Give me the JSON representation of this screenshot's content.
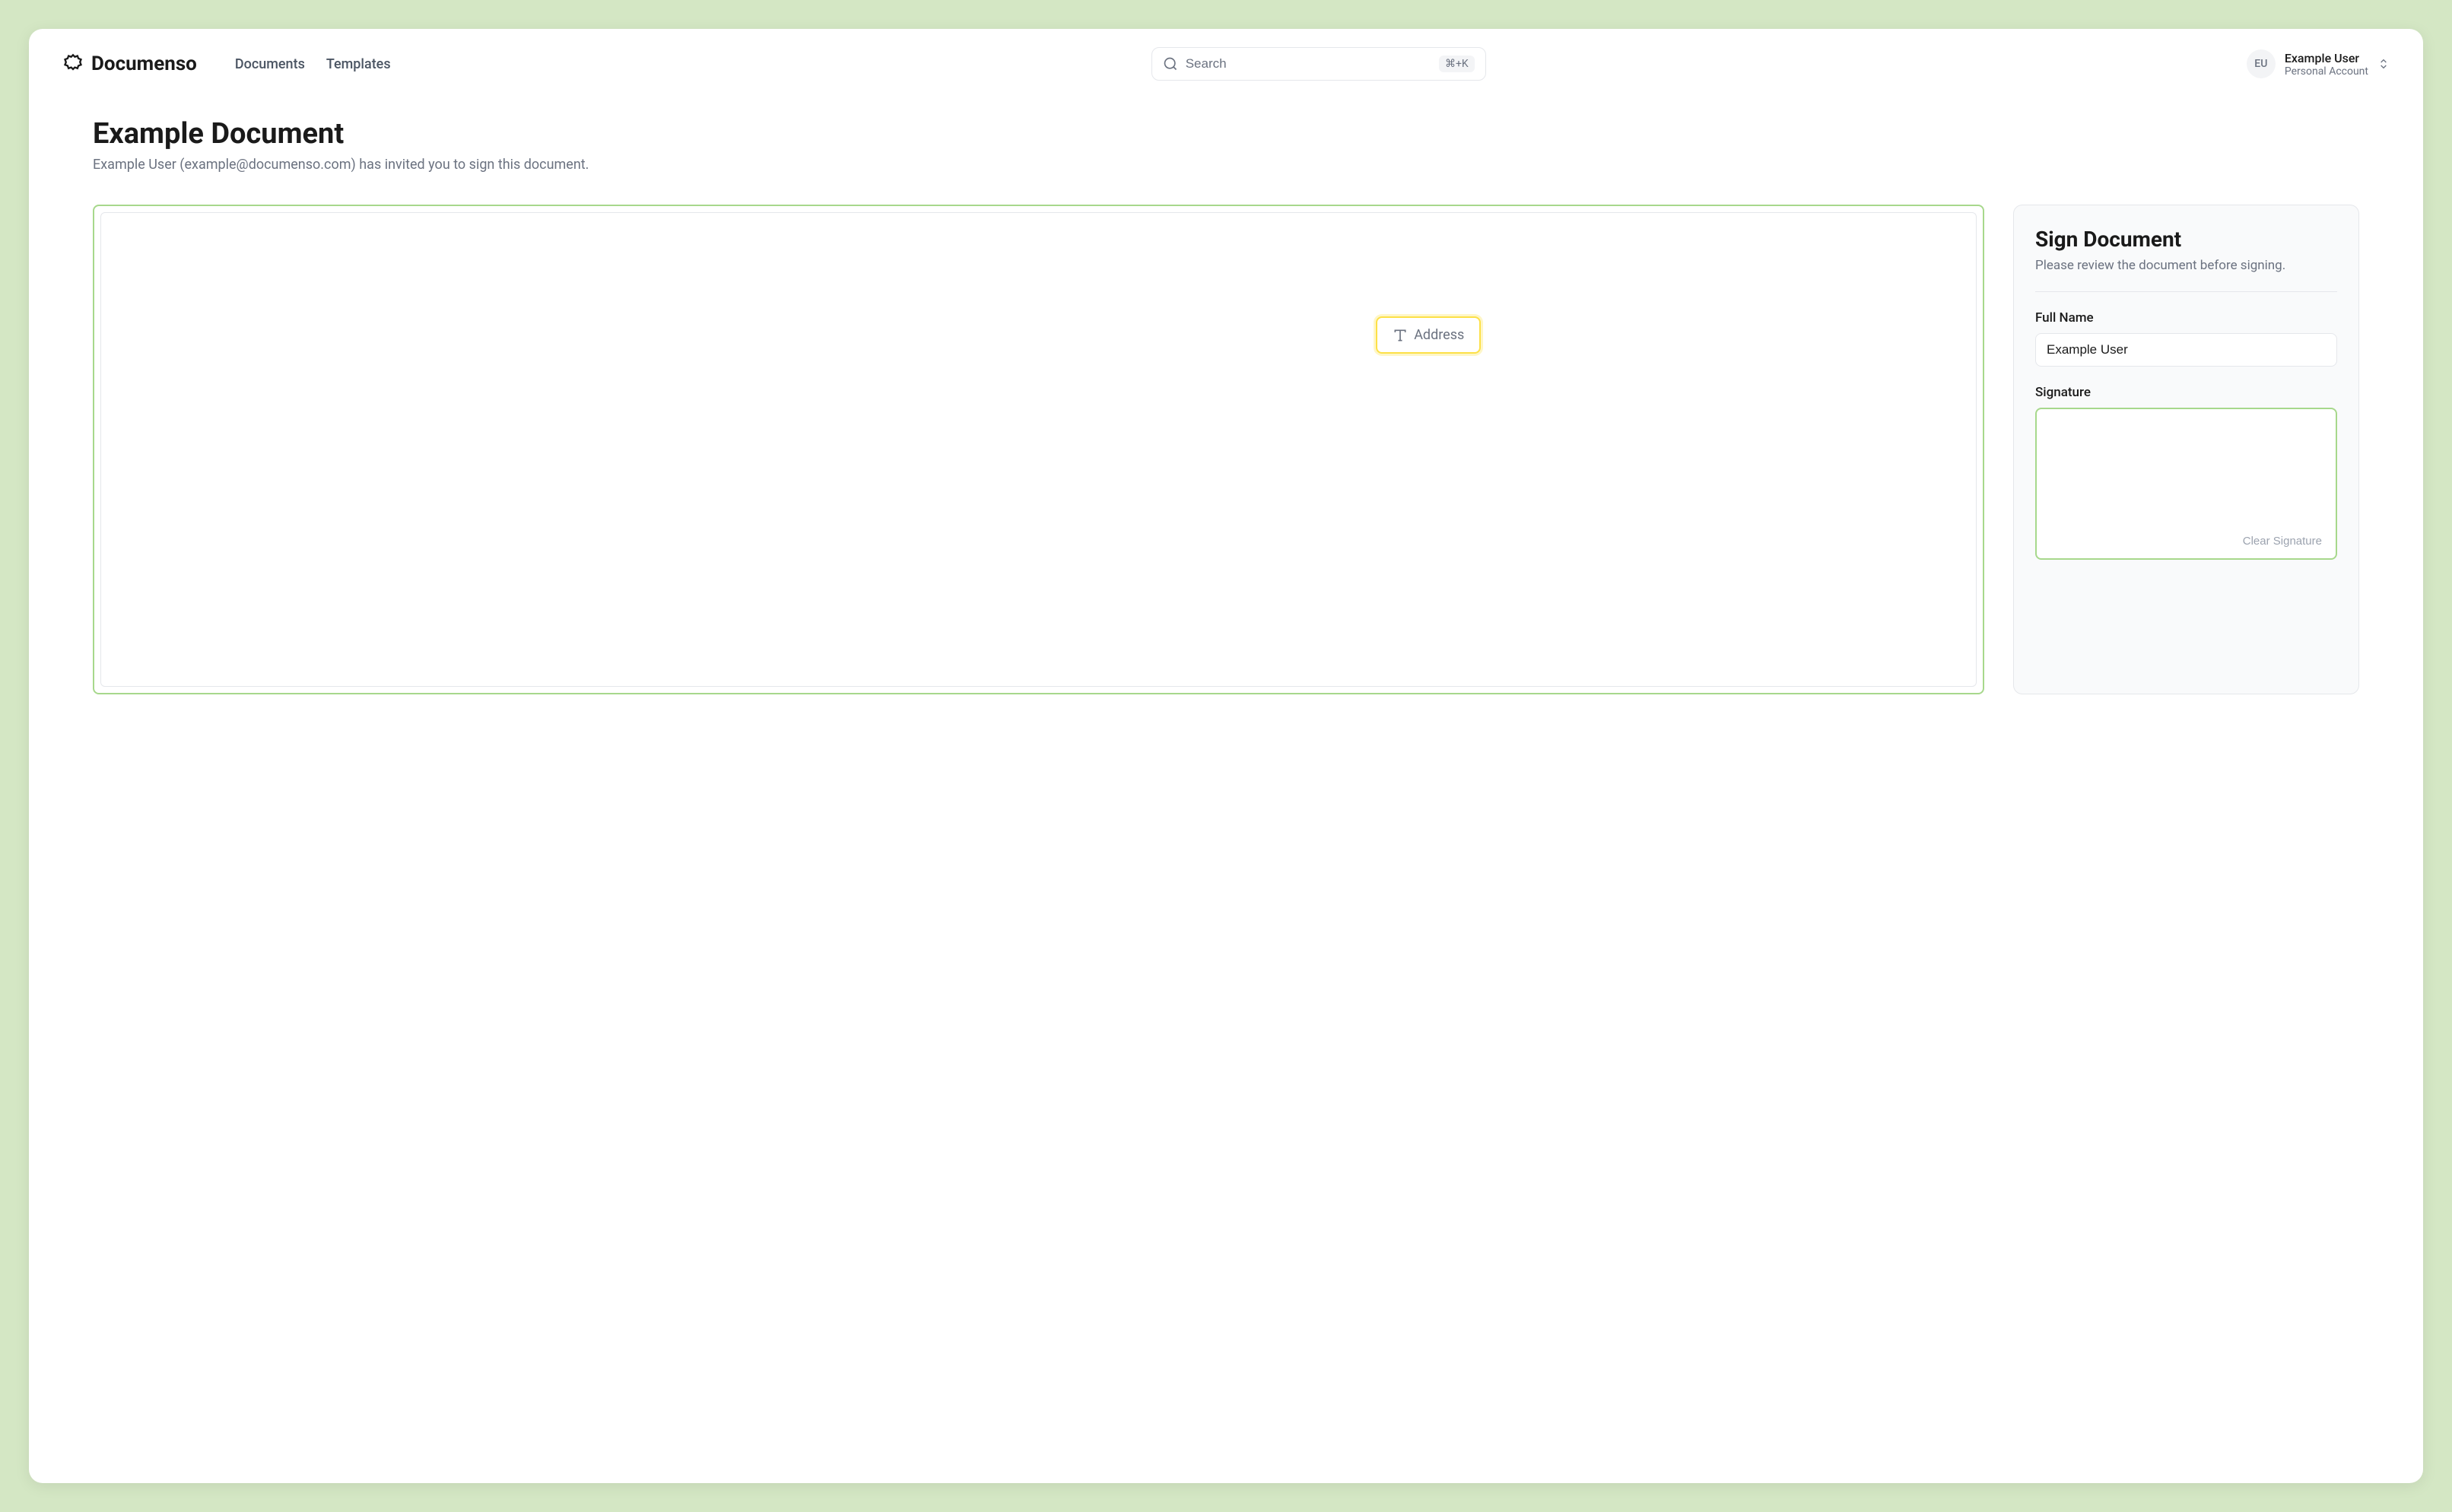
{
  "header": {
    "brand": "Documenso",
    "nav": {
      "documents": "Documents",
      "templates": "Templates"
    },
    "search": {
      "placeholder": "Search",
      "shortcut": "⌘+K"
    },
    "user": {
      "initials": "EU",
      "name": "Example User",
      "account": "Personal Account"
    }
  },
  "page": {
    "title": "Example Document",
    "subtitle": "Example User (example@documenso.com) has invited you to sign this document."
  },
  "document": {
    "field": {
      "label": "Address"
    }
  },
  "sidebar": {
    "title": "Sign Document",
    "subtitle": "Please review the document before signing.",
    "fullName": {
      "label": "Full Name",
      "value": "Example User"
    },
    "signature": {
      "label": "Signature",
      "clearButton": "Clear Signature"
    }
  }
}
